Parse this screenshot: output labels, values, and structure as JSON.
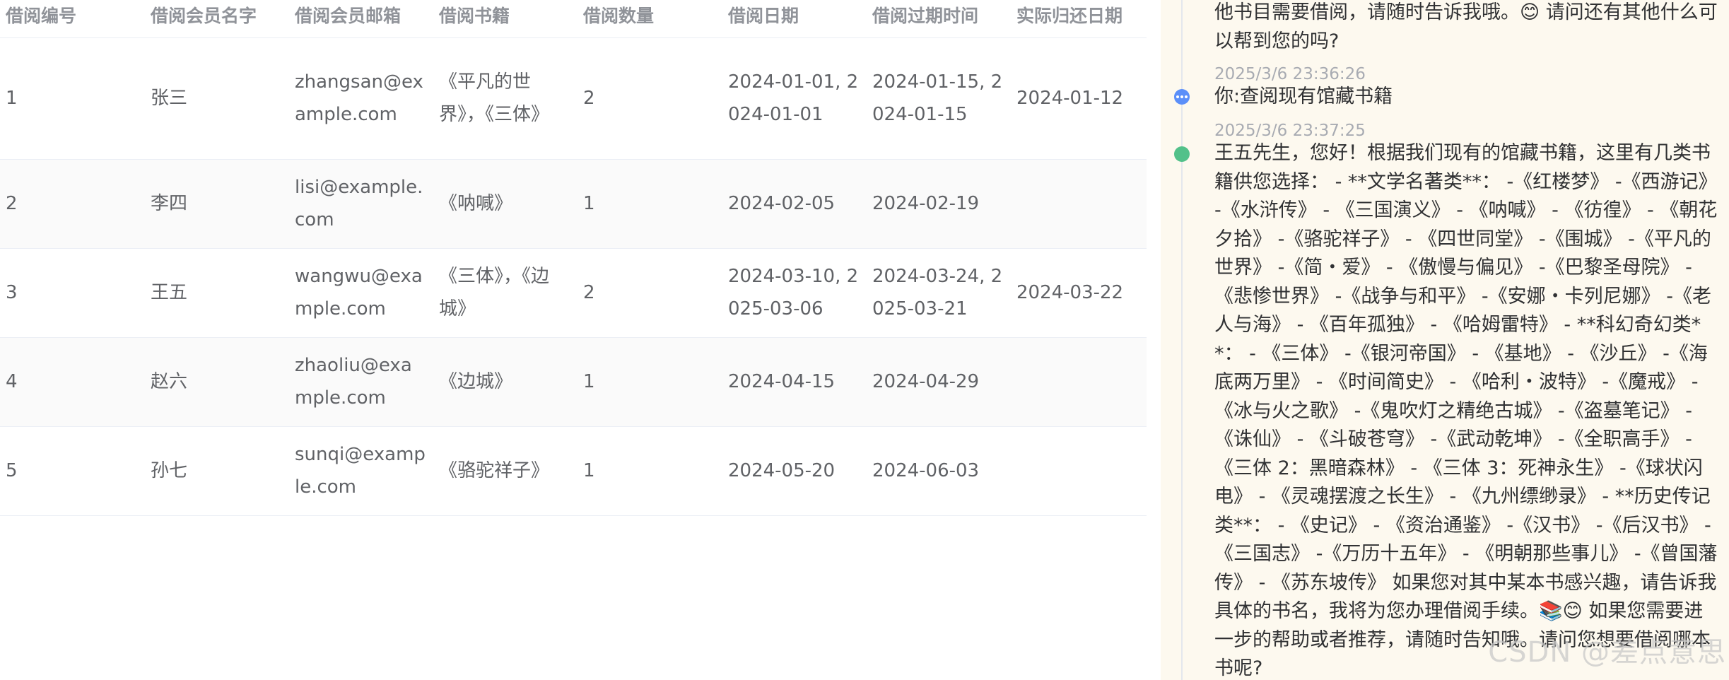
{
  "table": {
    "headers": [
      "借阅编号",
      "借阅会员名字",
      "借阅会员邮箱",
      "借阅书籍",
      "借阅数量",
      "借阅日期",
      "借阅过期时间",
      "实际归还日期"
    ],
    "rows": [
      {
        "id": "1",
        "name": "张三",
        "email": "zhangsan@example.com",
        "books": "《平凡的世界》，《三体》",
        "count": "2",
        "borrow_date": "2024-01-01, 2024-01-01",
        "due_date": "2024-01-15, 2024-01-15",
        "return_date": "2024-01-12"
      },
      {
        "id": "2",
        "name": "李四",
        "email": "lisi@example.com",
        "books": "《呐喊》",
        "count": "1",
        "borrow_date": "2024-02-05",
        "due_date": "2024-02-19",
        "return_date": ""
      },
      {
        "id": "3",
        "name": "王五",
        "email": "wangwu@example.com",
        "books": "《三体》，《边城》",
        "count": "2",
        "borrow_date": "2024-03-10, 2025-03-06",
        "due_date": "2024-03-24, 2025-03-21",
        "return_date": "2024-03-22"
      },
      {
        "id": "4",
        "name": "赵六",
        "email": "zhaoliu@example.com",
        "books": "《边城》",
        "count": "1",
        "borrow_date": "2024-04-15",
        "due_date": "2024-04-29",
        "return_date": ""
      },
      {
        "id": "5",
        "name": "孙七",
        "email": "sunqi@example.com",
        "books": "《骆驼祥子》",
        "count": "1",
        "borrow_date": "2024-05-20",
        "due_date": "2024-06-03",
        "return_date": ""
      }
    ]
  },
  "chat": {
    "previous_message": "他书目需要借阅，请随时告诉我哦。😊 请问还有其他什么可以帮到您的吗?",
    "messages": [
      {
        "role": "user",
        "time": "2025/3/6 23:36:26",
        "text": "你:查阅现有馆藏书籍"
      },
      {
        "role": "assistant",
        "time": "2025/3/6 23:37:25",
        "text": "王五先生，您好！根据我们现有的馆藏书籍，这里有几类书籍供您选择： - **文学名著类**： -《红楼梦》 -《西游记》 -《水浒传》 - 《三国演义》 - 《呐喊》 - 《彷徨》 - 《朝花夕拾》 -《骆驼祥子》 - 《四世同堂》 -《围城》 -《平凡的世界》 -《简・爱》 - 《傲慢与偏见》 -《巴黎圣母院》 -《悲惨世界》 -《战争与和平》 -《安娜・卡列尼娜》 -《老人与海》 - 《百年孤独》 - 《哈姆雷特》 - **科幻奇幻类**： - 《三体》 -《银河帝国》 - 《基地》 - 《沙丘》 -《海底两万里》 - 《时间简史》 - 《哈利・波特》 -《魔戒》 -《冰与火之歌》 -《鬼吹灯之精绝古城》 -《盗墓笔记》 -《诛仙》 - 《斗破苍穹》 -《武动乾坤》 -《全职高手》 - 《三体 2：黑暗森林》 - 《三体 3：死神永生》 -《球状闪电》 - 《灵魂摆渡之长生》 - 《九州缥缈录》 - **历史传记类**： - 《史记》 - 《资治通鉴》 -《汉书》 -《后汉书》 -《三国志》 -《万历十五年》 - 《明朝那些事儿》 -《曾国藩传》 - 《苏东坡传》 如果您对其中某本书感兴趣，请告诉我具体的书名，我将为您办理借阅手续。📚😊 如果您需要进一步的帮助或者推荐，请随时告知哦。请问您想要借阅哪本书呢?"
      }
    ]
  },
  "watermark": "CSDN @差点意思",
  "colors": {
    "header_text": "#909399",
    "cell_text": "#606266",
    "stripe": "#fafafa",
    "chat_bg": "#fdf9ef",
    "user_dot": "#5b8ff9",
    "bot_dot": "#52c18a"
  },
  "icons": [
    "user-timeline-dot-icon",
    "assistant-timeline-dot-icon"
  ]
}
